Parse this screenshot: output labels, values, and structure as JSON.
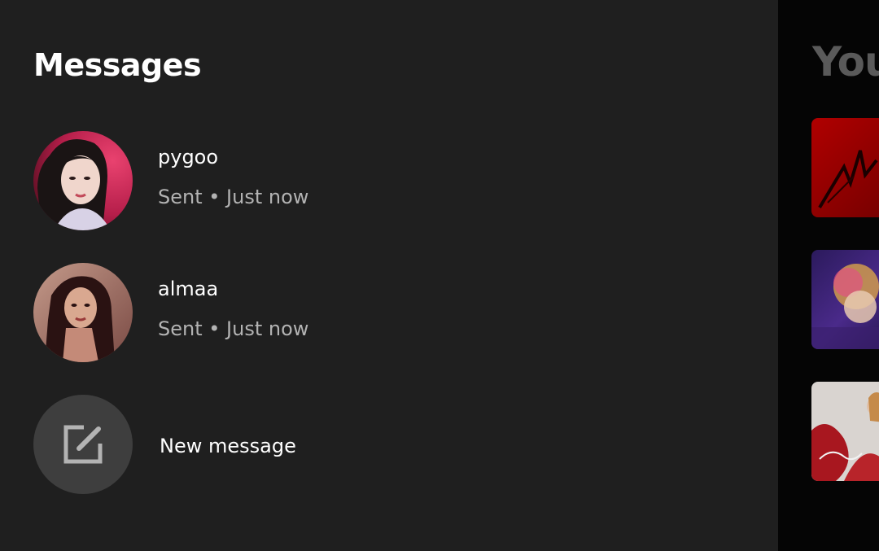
{
  "messages_panel": {
    "title": "Messages",
    "conversations": [
      {
        "name": "pygoo",
        "status": "Sent • Just now",
        "avatar": "profile-photo-pygoo"
      },
      {
        "name": "almaa",
        "status": "Sent • Just now",
        "avatar": "profile-photo-almaa"
      }
    ],
    "new_message": {
      "label": "New message",
      "icon": "compose-icon"
    }
  },
  "background_view": {
    "heading": "You",
    "albums": [
      {
        "art": "album-cover-red"
      },
      {
        "art": "album-cover-purple"
      },
      {
        "art": "album-cover-speak-now"
      }
    ]
  },
  "colors": {
    "panel_background": "#1f1f1f",
    "primary_text": "#ffffff",
    "secondary_text": "#b3b3b3",
    "compose_circle": "#3e3e3e"
  }
}
